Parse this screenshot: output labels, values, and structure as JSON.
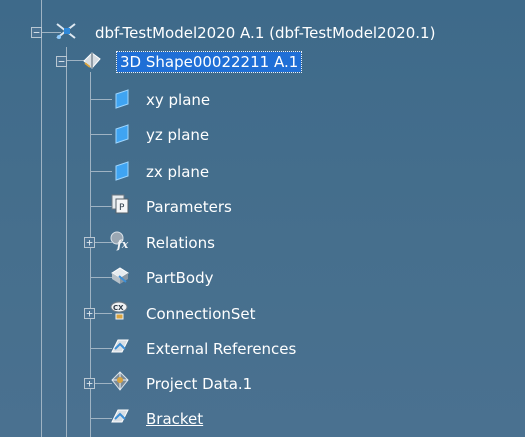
{
  "tree": {
    "root": {
      "label": "dbf-TestModel2020 A.1 (dbf-TestModel2020.1)",
      "icon": "product-icon",
      "expander": "−"
    },
    "part": {
      "label": "3D Shape00022211 A.1",
      "icon": "part-icon",
      "expander": "−"
    },
    "items": [
      {
        "label": "xy plane",
        "icon": "plane-icon"
      },
      {
        "label": "yz plane",
        "icon": "plane-icon"
      },
      {
        "label": "zx plane",
        "icon": "plane-icon"
      },
      {
        "label": "Parameters",
        "icon": "parameters-icon"
      },
      {
        "label": "Relations",
        "icon": "relations-icon",
        "expander": "+"
      },
      {
        "label": "PartBody",
        "icon": "partbody-icon"
      },
      {
        "label": "ConnectionSet",
        "icon": "connectionset-icon",
        "expander": "+"
      },
      {
        "label": "External References",
        "icon": "external-references-icon"
      },
      {
        "label": "Project Data.1",
        "icon": "project-data-icon",
        "expander": "+"
      },
      {
        "label": "Bracket",
        "icon": "bracket-icon"
      }
    ]
  },
  "colors": {
    "background": "#466f8d",
    "selection": "#1f6fd6",
    "text": "#ffffff",
    "tree_lines": "#9fb3c3"
  }
}
